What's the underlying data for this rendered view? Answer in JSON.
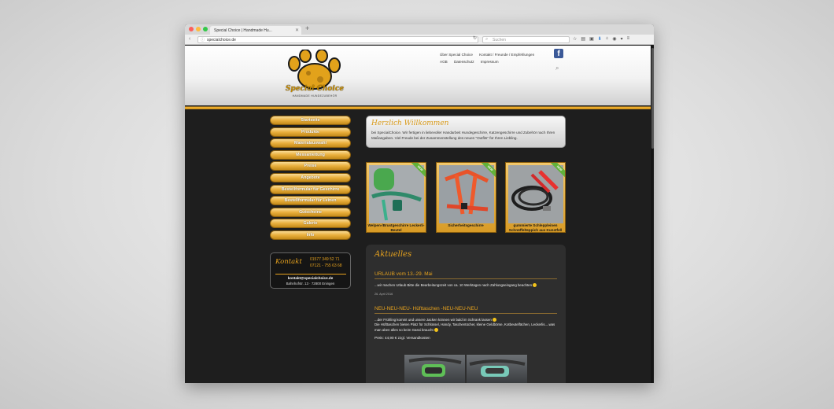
{
  "browser": {
    "tab_title": "Special Choice | Handmade Hu...",
    "url": "specialchoice.de",
    "search_placeholder": "Suchen",
    "colors": {
      "close": "#fc605c",
      "minimize": "#fdbc40",
      "maximize": "#34c84a"
    }
  },
  "header": {
    "logo_text": "Special Choice",
    "logo_subtitle": "HANDMADE HUNDEZUBEHÖR",
    "nav": [
      "Über Special Choice",
      "Kontakt / Freunde / Empfehlungen",
      "AGB",
      "Datenschutz",
      "Impressum"
    ],
    "facebook_letter": "f"
  },
  "sidebar": {
    "menu": [
      "Startseite",
      "Produkte",
      "Materialauswahl",
      "Messanleitung",
      "Preise",
      "Angebote",
      "Bestellformular für Geschirre",
      "Bestellformular für Leinen",
      "Gutscheine",
      "Galerie",
      "Info"
    ],
    "contact": {
      "title": "Kontakt",
      "phone1": "01577 349 52 71",
      "phone2": "07121 - 755 63 68",
      "email": "kontakt@specialchoice.de",
      "address": "Bahnhofstr. 13 · 72800 Eningen"
    }
  },
  "welcome": {
    "title": "Herzlich Willkommen",
    "text": "bei SpecialChoice. Wir fertigen in liebevoller Handarbeit Hundegeschirre, Katzengeschirre und Zubehör nach Ihren Maßangaben. Viel Freude bei der Zusammenstellung des neuen \"Outfits\" für Ihren Liebling."
  },
  "products": [
    {
      "label": "Welpen-/Brustgeschirre Leckerli-Beutel",
      "badge": "NEW"
    },
    {
      "label": "Sicherheitsgeschirre",
      "badge": "NEW"
    },
    {
      "label": "gummierte Schleppleinen Schnüffelteppich aus Kunstfell",
      "badge": "NEW"
    }
  ],
  "news": {
    "title": "Aktuelles",
    "items": [
      {
        "headline": "URLAUB vom 13.-29. Mai",
        "text": "...wir machen Urlaub  Bitte die Bearbeitungszeit von ca. 10 Werktagen nach Zahlungseingang beachten ",
        "date": "26. April 2016"
      },
      {
        "headline": "NEU-NEU-NEU- Hüfttaschen -NEU-NEU-NEU",
        "text1": "...der Frühling kommt und unsere Jacken können wir bald im Schrank lassen ",
        "text2": "Die Hüfttaschen bieten Platz für Schlüssel, Handy, Taschentücher, kleine Geldbörse, Kotbeutelfächen, Leckerlis....was man aben alles so beim Gassi braucht ",
        "price": "Preis: 44,90 € zzgl. Versandkosten"
      }
    ]
  }
}
